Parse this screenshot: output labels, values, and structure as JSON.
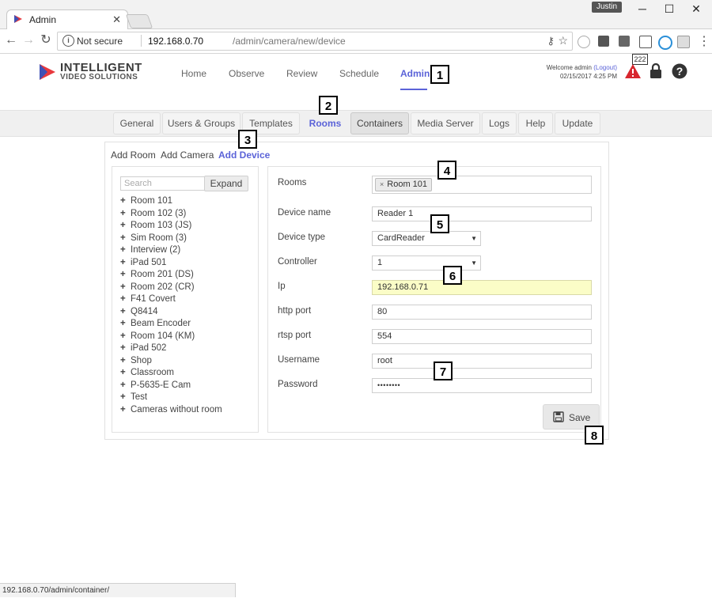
{
  "browser": {
    "tab_title": "Admin",
    "user_chip": "Justin",
    "security_label": "Not secure",
    "url_host": "192.168.0.70",
    "url_path": "/admin/camera/new/device",
    "status_url": "192.168.0.70/admin/container/"
  },
  "app": {
    "logo_line1": "INTELLIGENT",
    "logo_line2": "VIDEO SOLUTIONS",
    "nav": [
      "Home",
      "Observe",
      "Review",
      "Schedule",
      "Admin"
    ],
    "welcome_prefix": "Welcome admin",
    "logout_label": "(Logout)",
    "datetime": "02/15/2017 4:25 PM",
    "alert_count": "222",
    "accent_color": "#5b63d8"
  },
  "subnav": [
    "General",
    "Users & Groups",
    "Templates",
    "Rooms",
    "Containers",
    "Media Server",
    "Logs",
    "Help",
    "Update"
  ],
  "sublinks": [
    "Add Room",
    "Add Camera",
    "Add Device"
  ],
  "tree": {
    "search_placeholder": "Search",
    "expand_label": "Expand",
    "items": [
      "Room 101",
      "Room 102 (3)",
      "Room 103 (JS)",
      "Sim Room (3)",
      "Interview (2)",
      "iPad 501",
      "Room 201 (DS)",
      "Room 202 (CR)",
      "F41 Covert",
      "Q8414",
      "Beam Encoder",
      "Room 104 (KM)",
      "iPad 502",
      "Shop",
      "Classroom",
      "P-5635-E Cam",
      "Test",
      "Cameras without room"
    ]
  },
  "form": {
    "rooms_label": "Rooms",
    "rooms_tag": "Room 101",
    "rooms_tag_remove": "×",
    "device_name_label": "Device name",
    "device_name_value": "Reader 1",
    "device_type_label": "Device type",
    "device_type_value": "CardReader",
    "controller_label": "Controller",
    "controller_value": "1",
    "ip_label": "Ip",
    "ip_value": "192.168.0.71",
    "http_port_label": "http port",
    "http_port_value": "80",
    "rtsp_port_label": "rtsp port",
    "rtsp_port_value": "554",
    "username_label": "Username",
    "username_value": "root",
    "password_label": "Password",
    "password_value": "••••••••",
    "save_label": "Save"
  },
  "callouts": [
    "1",
    "2",
    "3",
    "4",
    "5",
    "6",
    "7",
    "8"
  ]
}
